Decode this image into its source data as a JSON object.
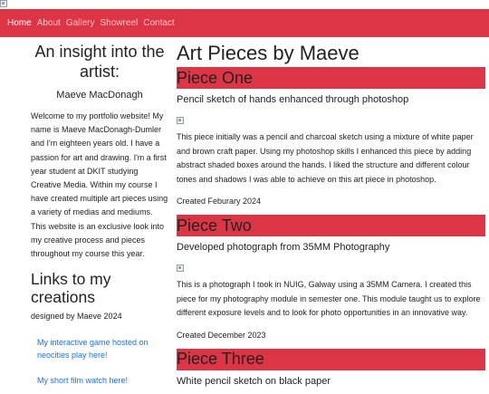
{
  "nav": {
    "items": [
      {
        "label": "Home",
        "active": true
      },
      {
        "label": "About",
        "active": false
      },
      {
        "label": "Gallery",
        "active": false
      },
      {
        "label": "Showreel",
        "active": false
      },
      {
        "label": "Contact",
        "active": false
      }
    ]
  },
  "sidebar": {
    "title": "An insight into the artist:",
    "name": "Maeve MacDonagh",
    "intro": "Welcome to my portfolio website! My name is Maeve MacDonagh-Dumler and I'm eighteen years old. I have a passion for art and drawing. I'm a first year student at DKIT studying Creative Media. Within my course I have created multiple art pieces using a variety of medias and mediums. This website is an exclusive look into my creative process and pieces throughout my course this year.",
    "links_title": "Links to my creations",
    "designed_by": "designed by Maeve 2024",
    "link_game": "My interactive game hosted on neocities play here!",
    "link_film": "My short film watch here!"
  },
  "main": {
    "title": "Art Pieces by Maeve",
    "pieces": [
      {
        "header": "Piece One",
        "subtitle": "Pencil sketch of hands enhanced through photoshop",
        "description": "This piece initially was a pencil and charcoal sketch using a mixture of white paper and brown craft paper. Using my photoshop skills I enhanced this piece by adding abstract shaded boxes around the hands. I liked the structure and different colour tones and shadows I was able to achieve on this art piece in photoshop.",
        "created": "Created Feburary 2024"
      },
      {
        "header": "Piece Two",
        "subtitle": "Developed photograph from 35MM Photography",
        "description": "This is a photograph I took in NUIG, Galway using a 35MM Camera. I created this piece for my photography module in semester one. This module taught us to explore different exposure levels and to look for photo opportunities in an innovative way.",
        "created": "Created December 2023"
      },
      {
        "header": "Piece Three",
        "subtitle": "White pencil sketch on black paper"
      }
    ]
  },
  "colors": {
    "accent": "#dc3545",
    "link": "#1a73e8"
  }
}
